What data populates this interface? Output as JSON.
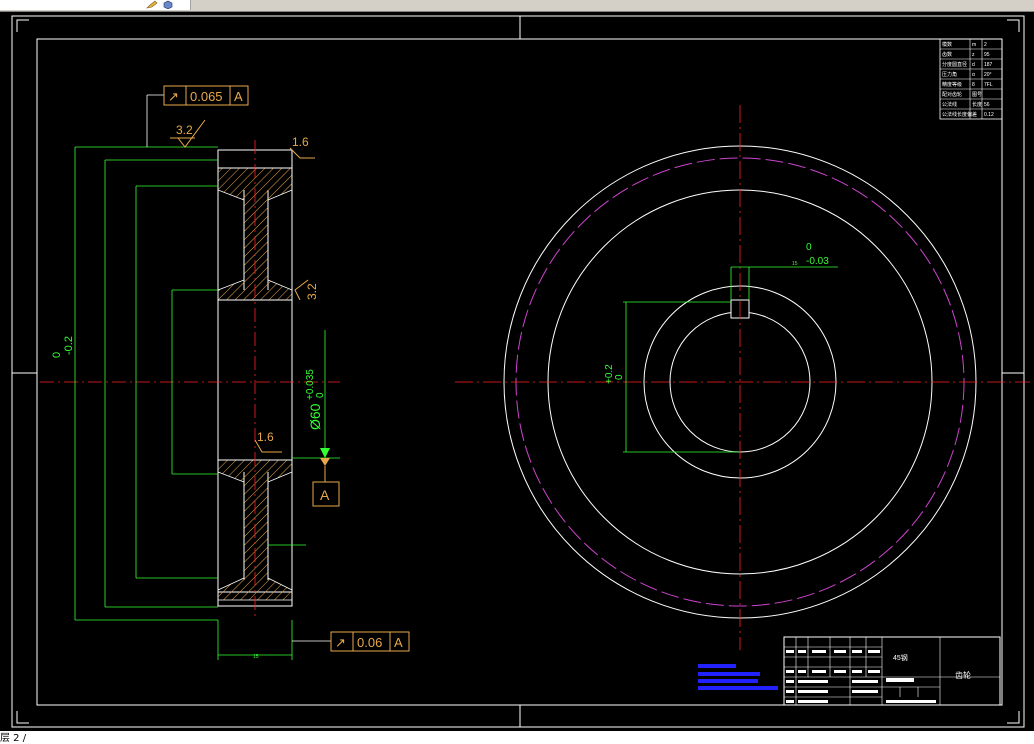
{
  "window": {
    "status_text": "层 2 /"
  },
  "colors": {
    "background": "#000000",
    "line": "#ffffff",
    "dimension": "#33ff33",
    "tolerance_frame": "#e8a84a",
    "center_line": "#ff2020",
    "pitch_circle": "#cc44cc",
    "hatch": "#e8a84a",
    "title_text": "#2222ff"
  },
  "drawing": {
    "left_view": {
      "runout_top": {
        "symbol": "↗",
        "value": "0.065",
        "datum": "A"
      },
      "runout_bottom": {
        "symbol": "↗",
        "value": "0.06",
        "datum": "A"
      },
      "roughness_top": "3.2",
      "roughness_face": "1.6",
      "roughness_side": "3.2",
      "roughness_bore": "1.6",
      "bore_dim": "Ø60",
      "bore_tol_upper": "+0.035",
      "bore_tol_lower": "0",
      "outer_tol_upper": "0",
      "outer_tol_lower": "-0.2",
      "datum_label": "A",
      "width_dim": "15"
    },
    "right_view": {
      "keyway_tol_upper": "0",
      "keyway_tol_lower": "-0.03",
      "keyway_depth_upper": "+0.2",
      "keyway_depth_lower": "0",
      "keyway_width": "15"
    }
  },
  "param_table": {
    "rows": [
      {
        "name": "模数",
        "sym": "m",
        "val": "2"
      },
      {
        "name": "齿数",
        "sym": "z",
        "val": "95"
      },
      {
        "name": "分度圆直径",
        "sym": "d",
        "val": "187"
      },
      {
        "name": "压力角",
        "sym": "α",
        "val": "20°"
      },
      {
        "name": "精度等级",
        "sym": "8",
        "val": "7FL"
      },
      {
        "name": "配对齿轮",
        "sym": "图号",
        "val": ""
      },
      {
        "name": "公法线",
        "sym": "长度",
        "val": "56"
      },
      {
        "name": "公法线长度偏差",
        "sym": "",
        "val": "0.12"
      }
    ]
  },
  "title_block": {
    "name": "齿轮",
    "material": "45钢"
  }
}
